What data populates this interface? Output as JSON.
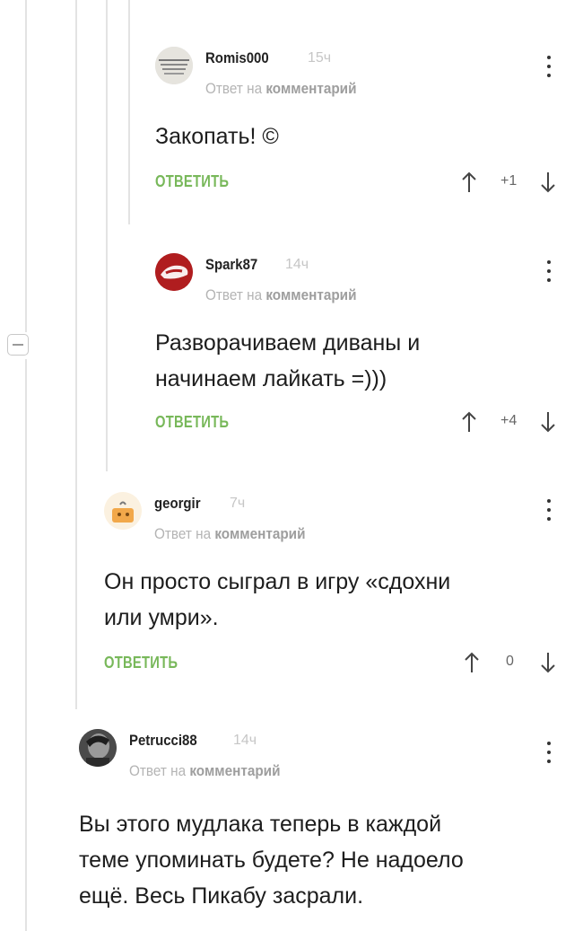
{
  "comments": [
    {
      "username": "Romis000",
      "time": "15ч",
      "reply_prefix": "Ответ на",
      "reply_target": "комментарий",
      "text_lines": [
        "Закопать! ©"
      ],
      "reply_label": "ОТВЕТИТЬ",
      "score": "+1"
    },
    {
      "username": "Spark87",
      "time": "14ч",
      "reply_prefix": "Ответ на",
      "reply_target": "комментарий",
      "text_lines": [
        "Разворачиваем диваны и",
        "начинаем лайкать =)))"
      ],
      "reply_label": "ОТВЕТИТЬ",
      "score": "+4"
    },
    {
      "username": "georgir",
      "time": "7ч",
      "reply_prefix": "Ответ на",
      "reply_target": "комментарий",
      "text_lines": [
        "Он просто сыграл в игру «сдохни",
        "или умри»."
      ],
      "reply_label": "ОТВЕТИТЬ",
      "score": "0"
    },
    {
      "username": "Petrucci88",
      "time": "14ч",
      "reply_prefix": "Ответ на",
      "reply_target": "комментарий",
      "text_lines": [
        "Вы этого мудлака теперь в каждой",
        "теме упоминать будете? Не надоело",
        "ещё. Весь Пикабу засрали."
      ]
    }
  ],
  "colors": {
    "reply_link": "#78b85a",
    "meta": "#b4b4b4",
    "thread_line": "#e3e3e3"
  },
  "icons": [
    "collapse-thread-icon",
    "kebab-menu-icon",
    "arrow-up-icon",
    "arrow-down-icon"
  ]
}
